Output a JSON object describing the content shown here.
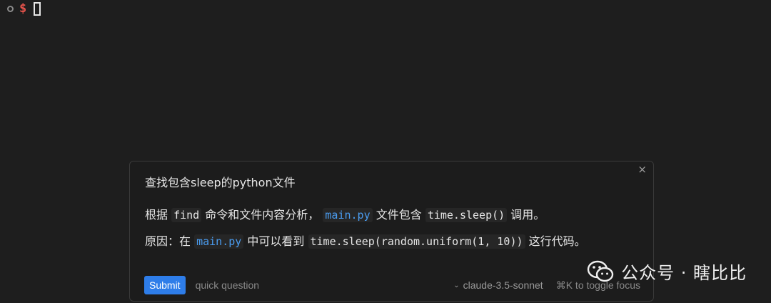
{
  "terminal": {
    "prompt_symbol": "$"
  },
  "panel": {
    "query": "查找包含sleep的python文件",
    "answer": {
      "line1_prefix": "根据 ",
      "line1_code_cmd": "find",
      "line1_middle": " 命令和文件内容分析， ",
      "line1_file": "main.py",
      "line1_mid2": " 文件包含 ",
      "line1_call": "time.sleep()",
      "line1_suffix": " 调用。",
      "line2_prefix": "原因：在 ",
      "line2_file": "main.py",
      "line2_middle": " 中可以看到 ",
      "line2_call": "time.sleep(random.uniform(1, 10))",
      "line2_suffix": " 这行代码。"
    },
    "close_symbol": "×",
    "footer": {
      "submit_label": "Submit",
      "input_placeholder": "quick question",
      "model_label": "claude-3.5-sonnet",
      "toggle_hint": "⌘K to toggle focus"
    }
  },
  "watermark": {
    "text": "公众号 · 瞎比比",
    "icon": "wechat-icon"
  },
  "colors": {
    "background": "#1e1e1e",
    "accent": "#2e7de9",
    "link": "#4a9cf0",
    "prompt": "#e5534b"
  }
}
